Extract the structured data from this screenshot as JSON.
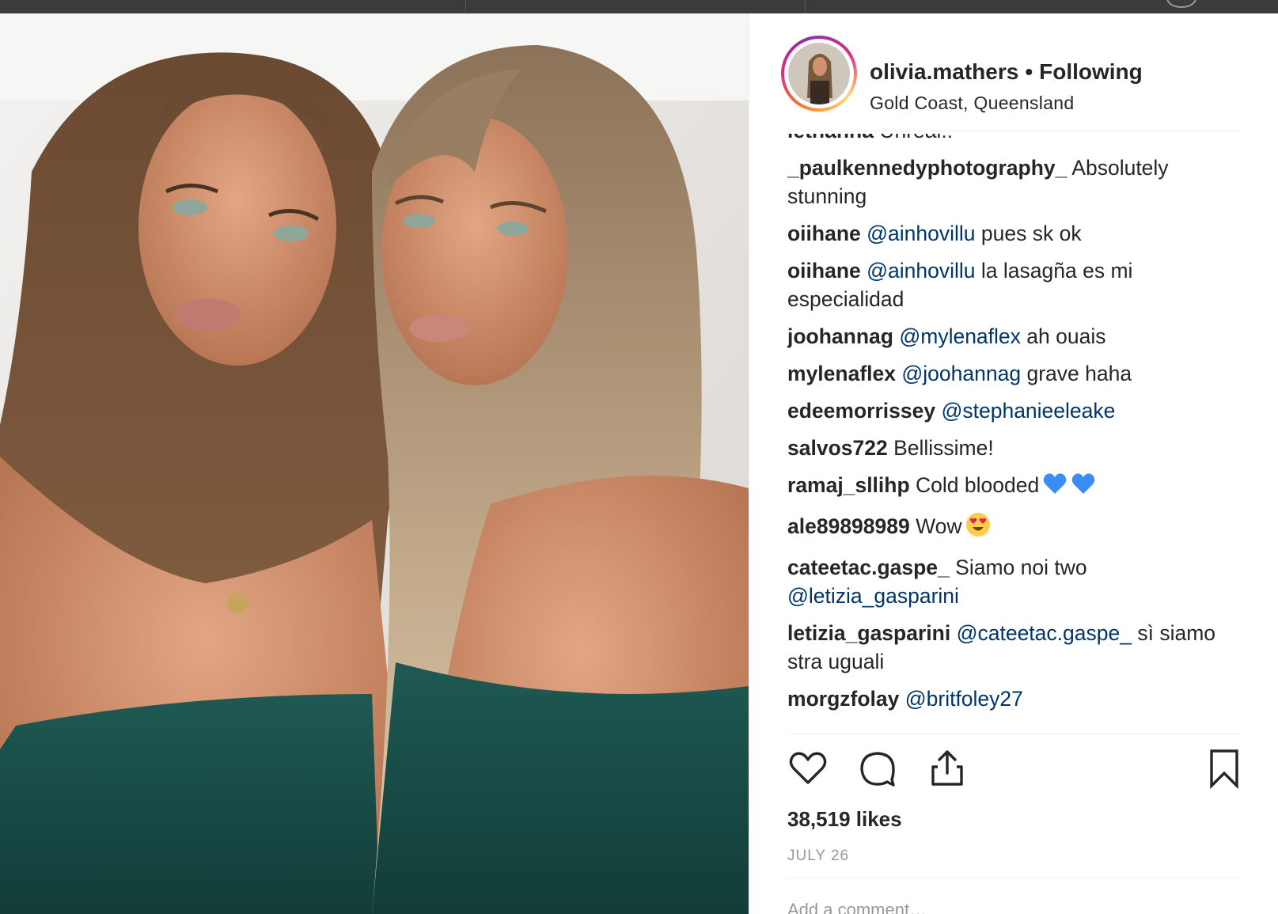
{
  "post": {
    "username": "olivia.mathers",
    "separator": "•",
    "follow_status": "Following",
    "location": "Gold Coast, Queensland"
  },
  "comments": [
    {
      "user": "_paulkennedyphotography_",
      "mention": "",
      "text": "Absolutely stunning",
      "emoji": []
    },
    {
      "user": "oiihane",
      "mention": "@ainhovillu",
      "text": "pues sk ok",
      "emoji": []
    },
    {
      "user": "oiihane",
      "mention": "@ainhovillu",
      "text": "la lasagña es mi especialidad",
      "emoji": []
    },
    {
      "user": "joohannag",
      "mention": "@mylenaflex",
      "text": "ah ouais",
      "emoji": []
    },
    {
      "user": "mylenaflex",
      "mention": "@joohannag",
      "text": "grave haha",
      "emoji": []
    },
    {
      "user": "edeemorrissey",
      "mention": "@stephanieeleake",
      "text": "",
      "emoji": []
    },
    {
      "user": "salvos722",
      "mention": "",
      "text": "Bellissime!",
      "emoji": []
    },
    {
      "user": "ramaj_sllihp",
      "mention": "",
      "text": "Cold blooded",
      "emoji": [
        "blue-heart-icon",
        "blue-heart-icon"
      ]
    },
    {
      "user": "ale89898989",
      "mention": "",
      "text": "Wow",
      "emoji": [
        "heart-eyes-icon"
      ]
    },
    {
      "user": "cateetac.gaspe_",
      "mention": "",
      "text": "Siamo noi two",
      "trailing_mention": "@letizia_gasparini",
      "emoji": []
    },
    {
      "user": "letizia_gasparini",
      "mention": "@cateetac.gaspe_",
      "text": "sì siamo stra uguali",
      "emoji": []
    },
    {
      "user": "morgzfolay",
      "mention": "@britfoley27",
      "text": "",
      "emoji": []
    }
  ],
  "partial_top_comment": {
    "user": "lethanna",
    "text": "Unreal!!"
  },
  "actions": {
    "like_icon": "heart-outline-icon",
    "comment_icon": "comment-bubble-icon",
    "share_icon": "share-upload-icon",
    "save_icon": "bookmark-icon"
  },
  "likes_label": "38,519 likes",
  "date_label": "JULY 26",
  "add_comment_placeholder": "Add a comment…",
  "colors": {
    "mention": "#003569",
    "text": "#262626",
    "muted": "#999999",
    "divider": "#efefef",
    "emoji_blue": "#3a8df5",
    "emoji_yellow": "#ffcc4d"
  }
}
